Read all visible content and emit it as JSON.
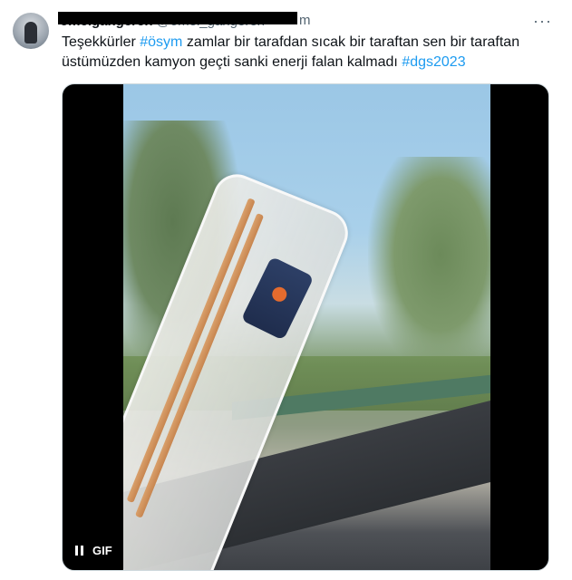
{
  "tweet": {
    "display_name": "omelgangeren",
    "handle": "@omel_gangeren",
    "handle_suffix": "m",
    "more_label": "···",
    "text_parts": [
      {
        "type": "text",
        "value": "Teşekkürler "
      },
      {
        "type": "hashtag",
        "value": "#ösym"
      },
      {
        "type": "text",
        "value": " zamlar bir tarafdan sıcak bir taraftan sen bir taraftan üstümüzden kamyon geçti sanki enerji falan kalmadı "
      },
      {
        "type": "hashtag",
        "value": "#dgs2023"
      }
    ]
  },
  "media": {
    "type": "GIF",
    "badge_label": "GIF",
    "pause_icon": "pause-icon",
    "colors": {
      "hashtag": "#1d9bf0",
      "text": "#0f1419",
      "muted": "#536471"
    }
  }
}
